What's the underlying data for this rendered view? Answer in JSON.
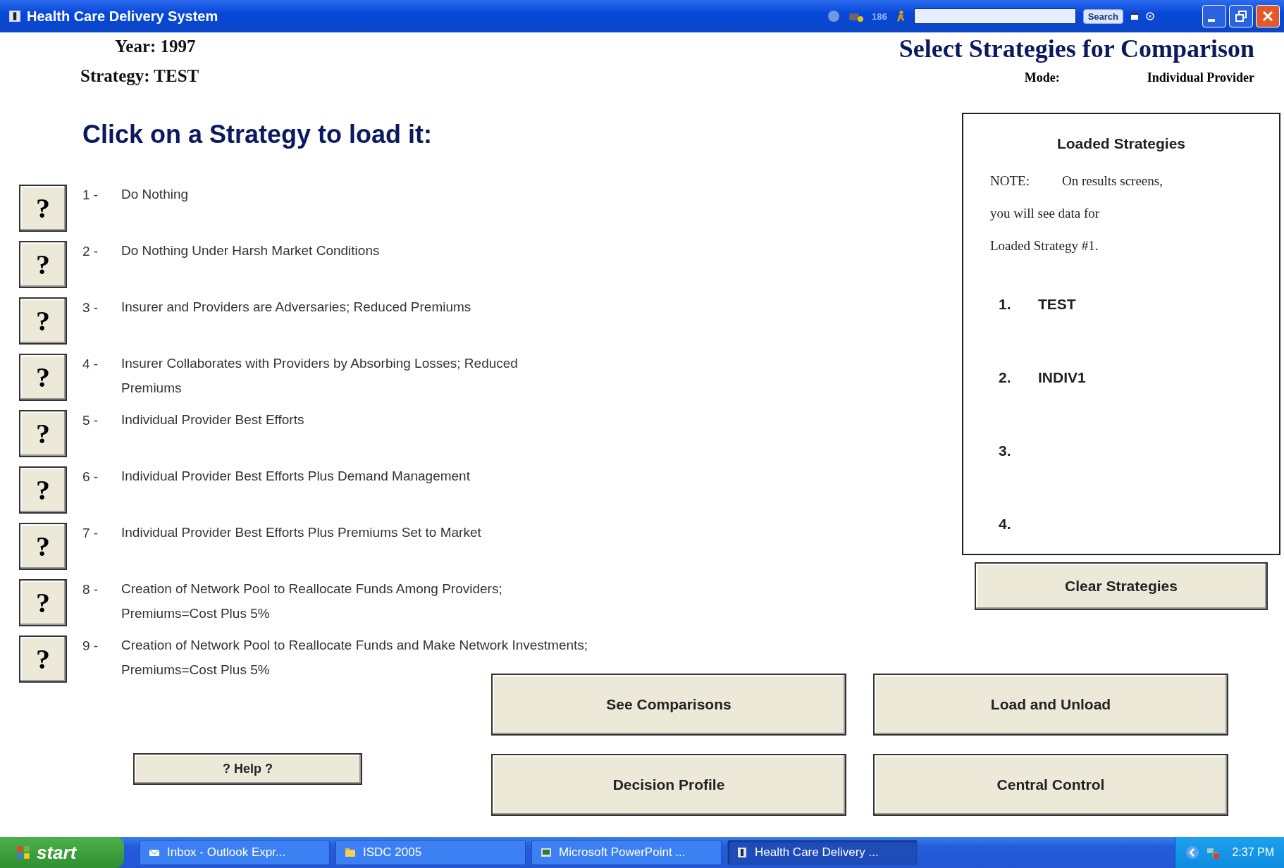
{
  "window": {
    "title": "Health Care Delivery System",
    "toolbar": {
      "counter": "186",
      "search_button": "Search"
    }
  },
  "header": {
    "year": "Year: 1997",
    "strategy": "Strategy: TEST",
    "title": "Select Strategies for Comparison",
    "mode_label": "Mode:",
    "mode_value": "Individual Provider"
  },
  "heading": "Click on a Strategy to load it:",
  "strategies": [
    {
      "number": "1 -",
      "label": "Do Nothing",
      "help": "?"
    },
    {
      "number": "2 -",
      "label": "Do Nothing Under Harsh Market Conditions",
      "help": "?"
    },
    {
      "number": "3 -",
      "label": "Insurer and Providers are Adversaries; Reduced Premiums",
      "help": "?"
    },
    {
      "number": "4 -",
      "label": "Insurer Collaborates with Providers by Absorbing Losses; Reduced Premiums",
      "help": "?"
    },
    {
      "number": "5 -",
      "label": "Individual Provider Best Efforts",
      "help": "?"
    },
    {
      "number": "6 -",
      "label": "Individual Provider Best Efforts Plus Demand Management",
      "help": "?"
    },
    {
      "number": "7 -",
      "label": "Individual Provider Best Efforts Plus Premiums Set to Market",
      "help": "?"
    },
    {
      "number": "8 -",
      "label": "Creation of Network Pool to Reallocate Funds Among Providers; Premiums=Cost Plus 5%",
      "help": "?"
    },
    {
      "number": "9 -",
      "label": "Creation of Network Pool to Reallocate Funds and Make Network Investments; Premiums=Cost Plus 5%",
      "help": "?"
    }
  ],
  "loaded": {
    "title": "Loaded Strategies",
    "note_label": "NOTE:",
    "note_lines": [
      "On results screens,",
      "you will see data for",
      "Loaded Strategy #1."
    ],
    "slots": [
      {
        "number": "1.",
        "name": "TEST"
      },
      {
        "number": "2.",
        "name": "INDIV1"
      },
      {
        "number": "3."
      },
      {
        "number": "4."
      }
    ]
  },
  "clear_button": "Clear Strategies",
  "help_button": "? Help ?",
  "actions": [
    "See Comparisons",
    "Load and Unload",
    "Decision Profile",
    "Central Control"
  ],
  "taskbar": {
    "start": "start",
    "tasks": [
      {
        "label": "Inbox - Outlook Expr...",
        "kind": "mail",
        "selected": false
      },
      {
        "label": "ISDC 2005",
        "kind": "folder",
        "selected": false
      },
      {
        "label": "Microsoft PowerPoint ...",
        "kind": "slides",
        "selected": false
      },
      {
        "label": "Health Care Delivery ...",
        "kind": "app",
        "selected": true
      }
    ],
    "clock": "2:37 PM"
  }
}
